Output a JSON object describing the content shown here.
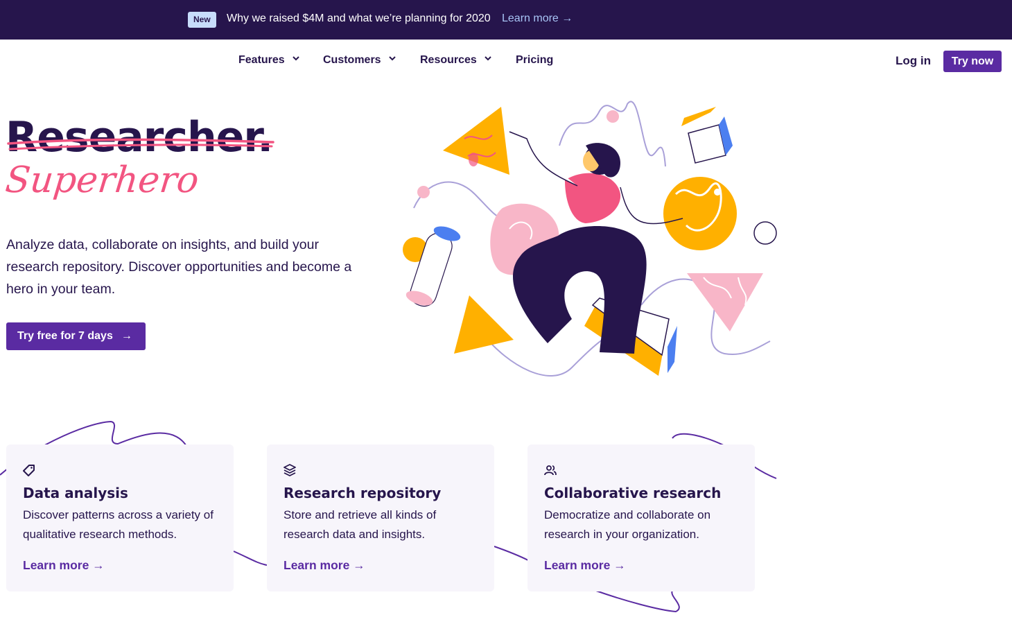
{
  "announcement": {
    "badge": "New",
    "message": "Why we raised $4M and what we’re planning for 2020",
    "link": "Learn more →"
  },
  "nav": {
    "items": [
      {
        "label": "Features",
        "dropdown": true
      },
      {
        "label": "Customers",
        "dropdown": true
      },
      {
        "label": "Resources",
        "dropdown": true
      },
      {
        "label": "Pricing",
        "dropdown": false
      }
    ],
    "login": "Log in",
    "try_now": "Try now"
  },
  "hero": {
    "struck_word": "Researcher",
    "period": ".",
    "script_word": "Superhero",
    "description": "Analyze data, collaborate on insights, and build your research repository. Discover opportunities and become a hero in your team.",
    "cta": "Try free for 7 days"
  },
  "cards": [
    {
      "icon": "tag-icon",
      "title": "Data analysis",
      "description": "Discover patterns across a variety of qualitative research methods.",
      "link": "Learn more →"
    },
    {
      "icon": "layers-icon",
      "title": "Research repository",
      "description": "Store and retrieve all kinds of research data and insights.",
      "link": "Learn more →"
    },
    {
      "icon": "users-icon",
      "title": "Collaborative research",
      "description": "Democratize and collaborate on research in your organization.",
      "link": "Learn more →"
    }
  ],
  "colors": {
    "primary": "#5a2ba2",
    "dark": "#26154c",
    "pink": "#f25581",
    "yellow": "#ffb000",
    "blue": "#4c7ff0",
    "light_pink": "#f8b6c8",
    "card_bg": "#f7f5fb"
  }
}
